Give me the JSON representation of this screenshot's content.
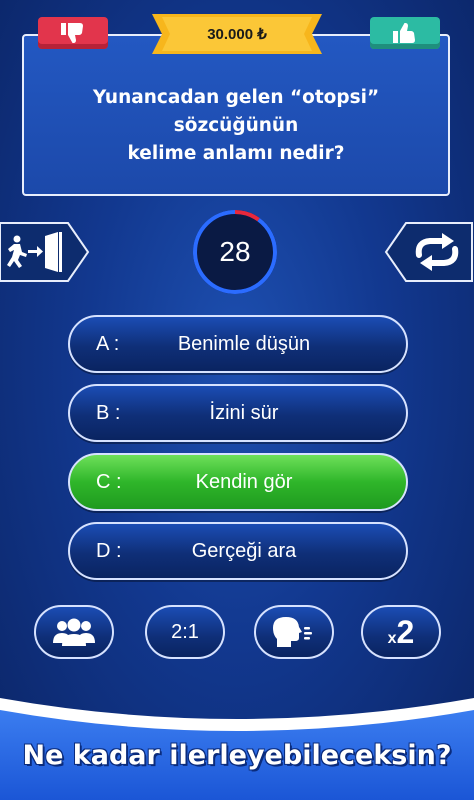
{
  "header": {
    "prize": "30.000 ₺",
    "dislike_icon": "thumbs-down-icon",
    "like_icon": "thumbs-up-icon"
  },
  "question": {
    "line1": "Yunancadan gelen “otopsi” sözcüğünün",
    "line2": "kelime anlamı nedir?"
  },
  "timer": {
    "seconds": "28",
    "remaining_fraction": 0.9
  },
  "controls": {
    "exit_icon": "exit-door-icon",
    "swap_icon": "swap-arrows-icon"
  },
  "answers": [
    {
      "letter": "A :",
      "text": "Benimle düşün",
      "state": "default"
    },
    {
      "letter": "B :",
      "text": "İzini sür",
      "state": "default"
    },
    {
      "letter": "C :",
      "text": "Kendin gör",
      "state": "correct"
    },
    {
      "letter": "D :",
      "text": "Gerçeği ara",
      "state": "default"
    }
  ],
  "jokers": {
    "audience_icon": "audience-icon",
    "fifty_label": "2:1",
    "call_icon": "speaking-head-icon",
    "double_x": "x",
    "double_2": "2"
  },
  "banner": {
    "slogan": "Ne kadar ilerleyebileceksin?"
  },
  "colors": {
    "correct": "#2fb62a",
    "dislike": "#e2354c",
    "like": "#2cbba3",
    "prize_bg": "#f7b61c",
    "timer_warning": "#e8283c"
  }
}
